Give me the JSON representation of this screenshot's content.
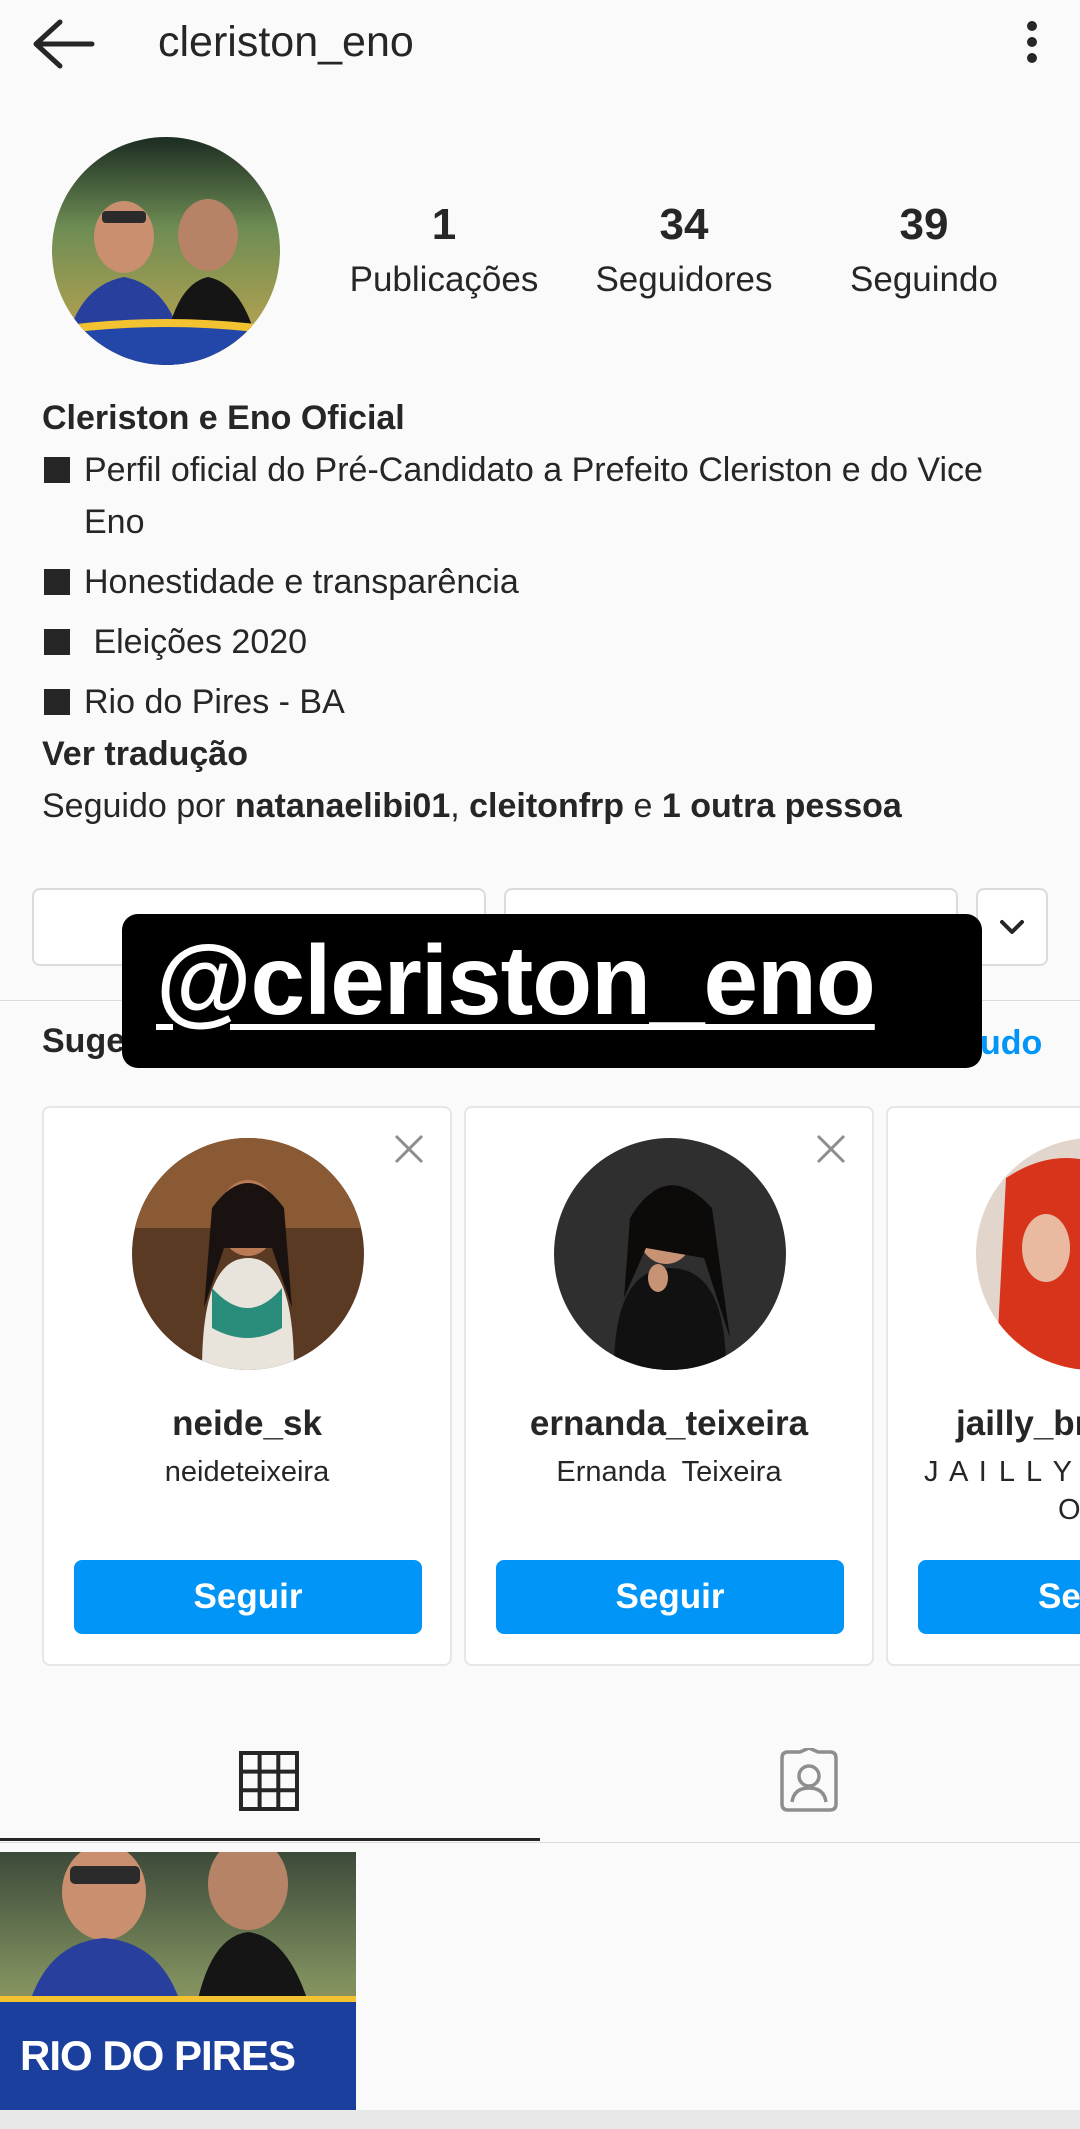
{
  "header": {
    "username": "cleriston_eno"
  },
  "stats": [
    {
      "count": "1",
      "label": "Publicações"
    },
    {
      "count": "34",
      "label": "Seguidores"
    },
    {
      "count": "39",
      "label": "Seguindo"
    }
  ],
  "bio": {
    "name": "Cleriston e Eno Oficial",
    "line1": "Perfil oficial do Pré-Candidato a Prefeito Cleriston e do Vice Eno",
    "line2": "Honestidade e transparência",
    "line3": " Eleições 2020",
    "line4": "Rio do Pires - BA",
    "translate": "Ver tradução",
    "followed_prefix": "Seguido por ",
    "followed_user1": "natanaelibi01",
    "followed_sep": ", ",
    "followed_user2": "cleitonfrp",
    "followed_and": " e ",
    "followed_others": "1 outra pessoa"
  },
  "overlay": {
    "text": "@cleriston_eno"
  },
  "suggestions": {
    "title": "Suge",
    "see_all": "udo",
    "cards": [
      {
        "username": "neide_sk",
        "full_name": "neideteixeira",
        "button": "Seguir"
      },
      {
        "username": "ernanda_teixeira",
        "full_name": "Ernanda  Teixeira",
        "button": "Seguir"
      },
      {
        "username": "jailly_br",
        "full_name": "J A I L L Y",
        "full_name_2": "O",
        "button": "Se"
      }
    ]
  },
  "post": {
    "caption": "RIO DO PIRES"
  },
  "colors": {
    "accent": "#0095f6",
    "text": "#262626",
    "background": "#fafafa",
    "border": "#dbdbdb"
  }
}
